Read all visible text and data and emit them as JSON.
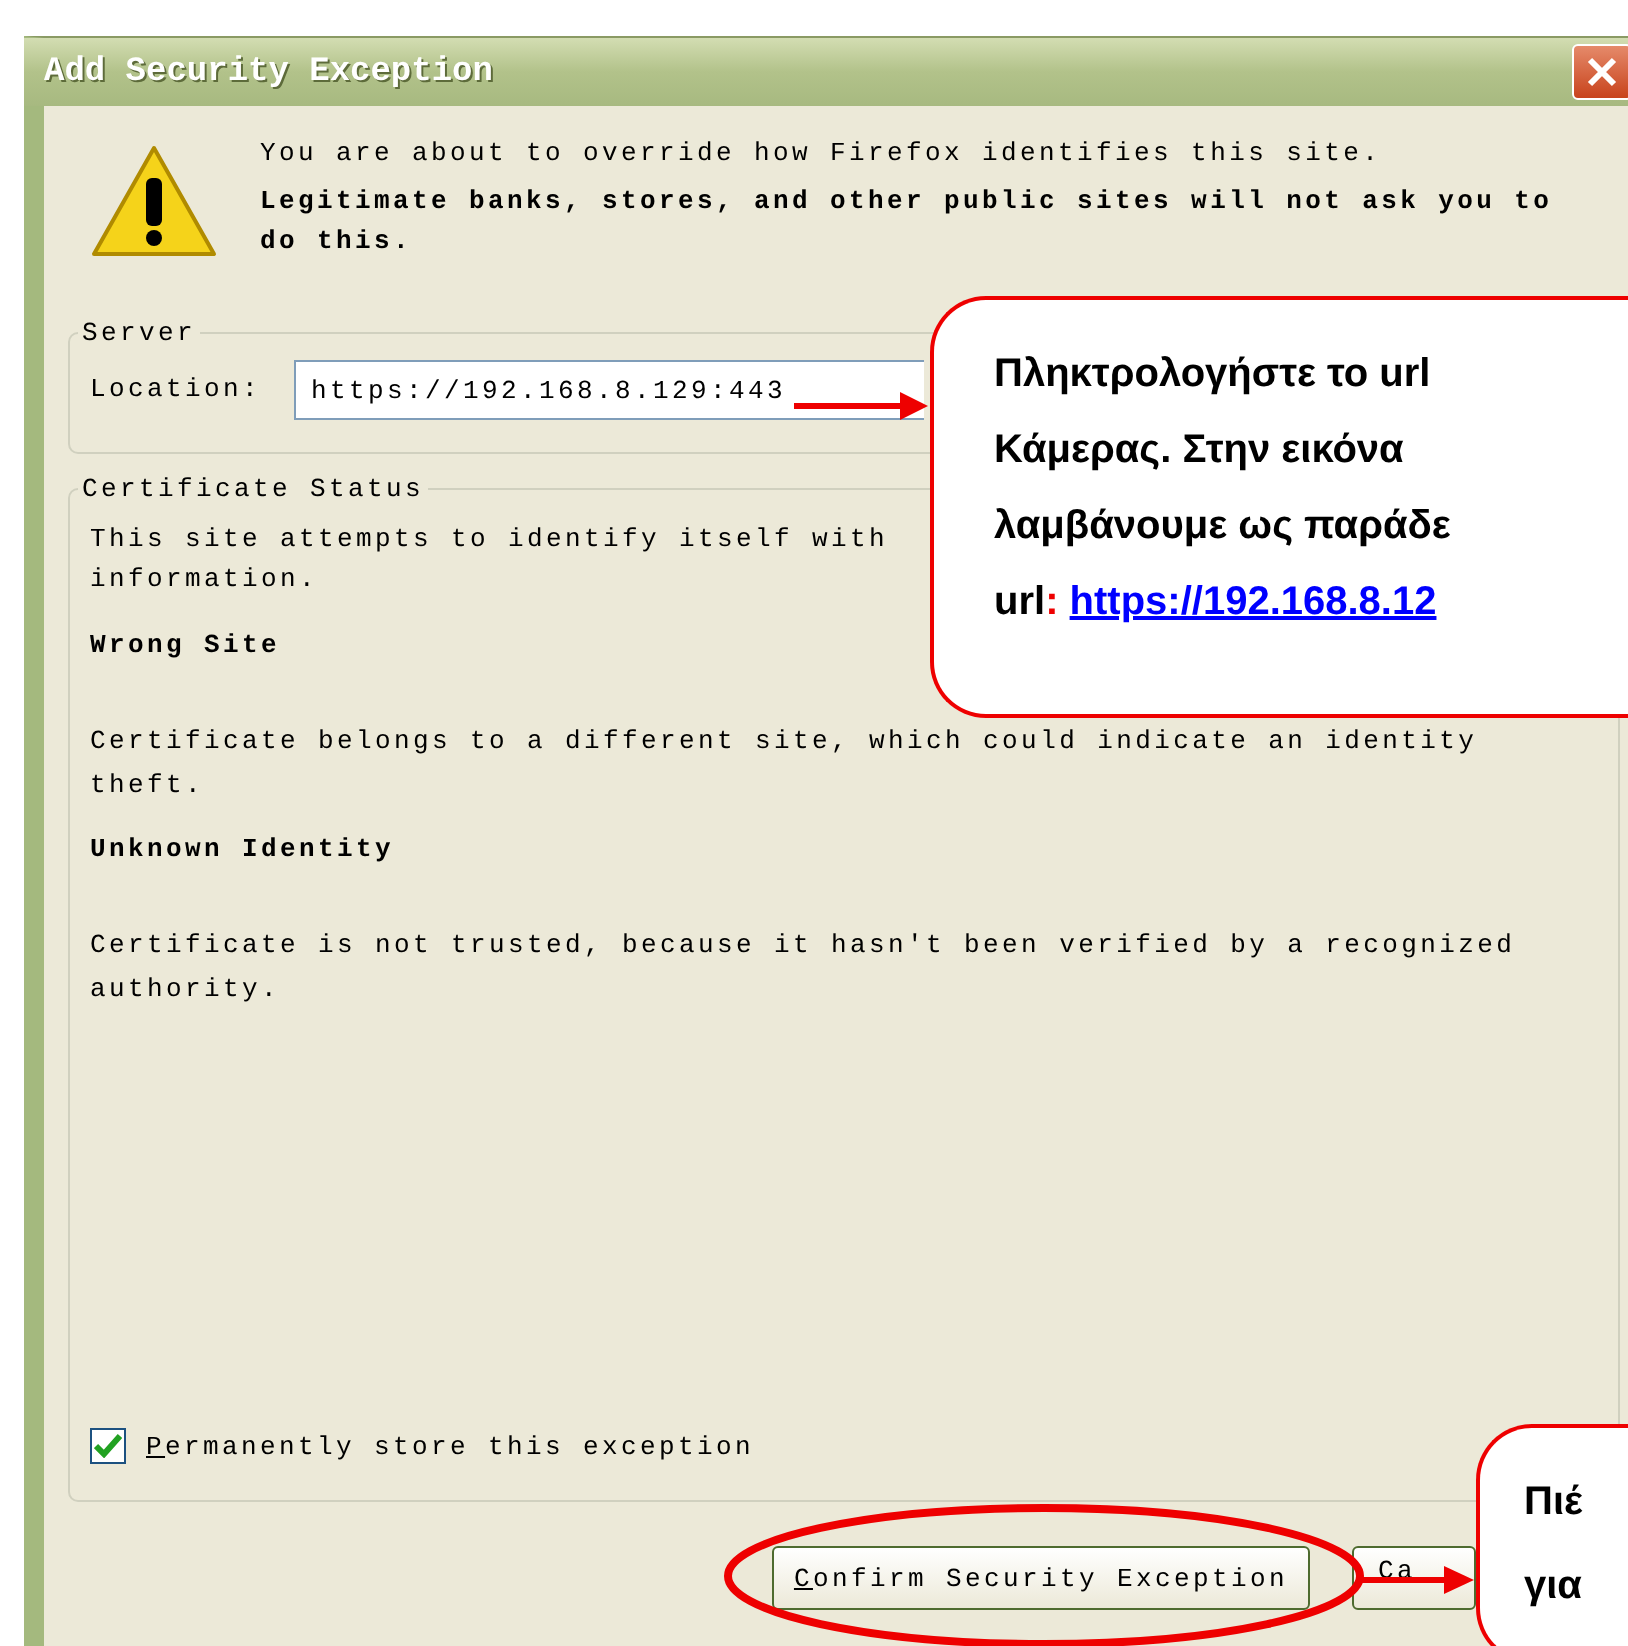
{
  "window": {
    "title": "Add Security Exception"
  },
  "warning": {
    "line_1": "You are about to override how Firefox identifies this site.",
    "line_2": "Legitimate banks, stores, and other public sites will not ask you to do this."
  },
  "server": {
    "legend": "Server",
    "location_label": "Location:",
    "location_value": "https://192.168.8.129:443"
  },
  "certificate_status": {
    "legend": "Certificate Status",
    "intro_lines": [
      "This site attempts to identify itself with",
      "information."
    ],
    "sections": [
      {
        "heading": "Wrong Site",
        "text": "Certificate belongs to a different site, which could indicate an identity theft."
      },
      {
        "heading": "Unknown Identity",
        "text": "Certificate is not trusted, because it hasn't been verified by a recognized authority."
      }
    ]
  },
  "permanent_checkbox": {
    "label": "Permanently store this exception",
    "checked": true
  },
  "buttons": [
    {
      "label": "Confirm Security Exception",
      "kind": "confirm"
    },
    {
      "label": "Ca",
      "kind": "cancel"
    }
  ],
  "callouts": [
    {
      "kind": "location",
      "lines": [
        "Πληκτρολογήστε το url",
        "Κάμερας. Στην εικόνα",
        "λαμβάνουμε ως παράδε"
      ],
      "url_label": "url",
      "url_separator": ":",
      "url": "https://192.168.8.12"
    },
    {
      "kind": "confirm",
      "lines": [
        "Πιέ",
        "για"
      ]
    }
  ]
}
